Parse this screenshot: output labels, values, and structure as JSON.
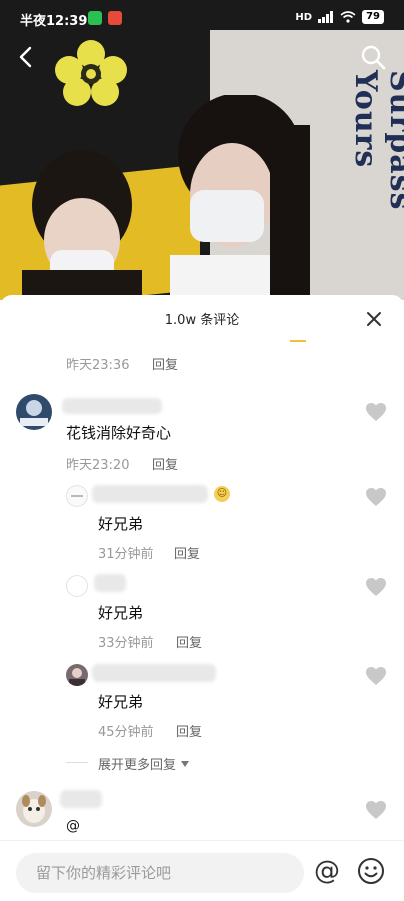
{
  "status": {
    "time": "半夜12:39",
    "network": "HD",
    "battery": "79"
  },
  "video": {
    "background_text": "Surpass Yours"
  },
  "sheet": {
    "title": "1.0w 条评论"
  },
  "comments": {
    "prev_meta": {
      "time": "昨天23:36",
      "reply": "回复"
    },
    "main": {
      "text": "花钱消除好奇心",
      "time": "昨天23:20",
      "reply": "回复"
    },
    "replies": [
      {
        "text": "好兄弟",
        "time": "31分钟前",
        "reply": "回复"
      },
      {
        "text": "好兄弟",
        "time": "33分钟前",
        "reply": "回复"
      },
      {
        "text": "好兄弟",
        "time": "45分钟前",
        "reply": "回复"
      }
    ],
    "expand_more": "展开更多回复",
    "last": {
      "text": "@"
    }
  },
  "input": {
    "placeholder": "留下你的精彩评论吧",
    "at_symbol": "@"
  },
  "colors": {
    "heart": "#c8c8c8",
    "accent": "#f0c040"
  },
  "icons": [
    "back-icon",
    "search-icon",
    "close-icon",
    "heart-icon",
    "chevron-down-icon",
    "emoji-icon",
    "at-icon"
  ]
}
